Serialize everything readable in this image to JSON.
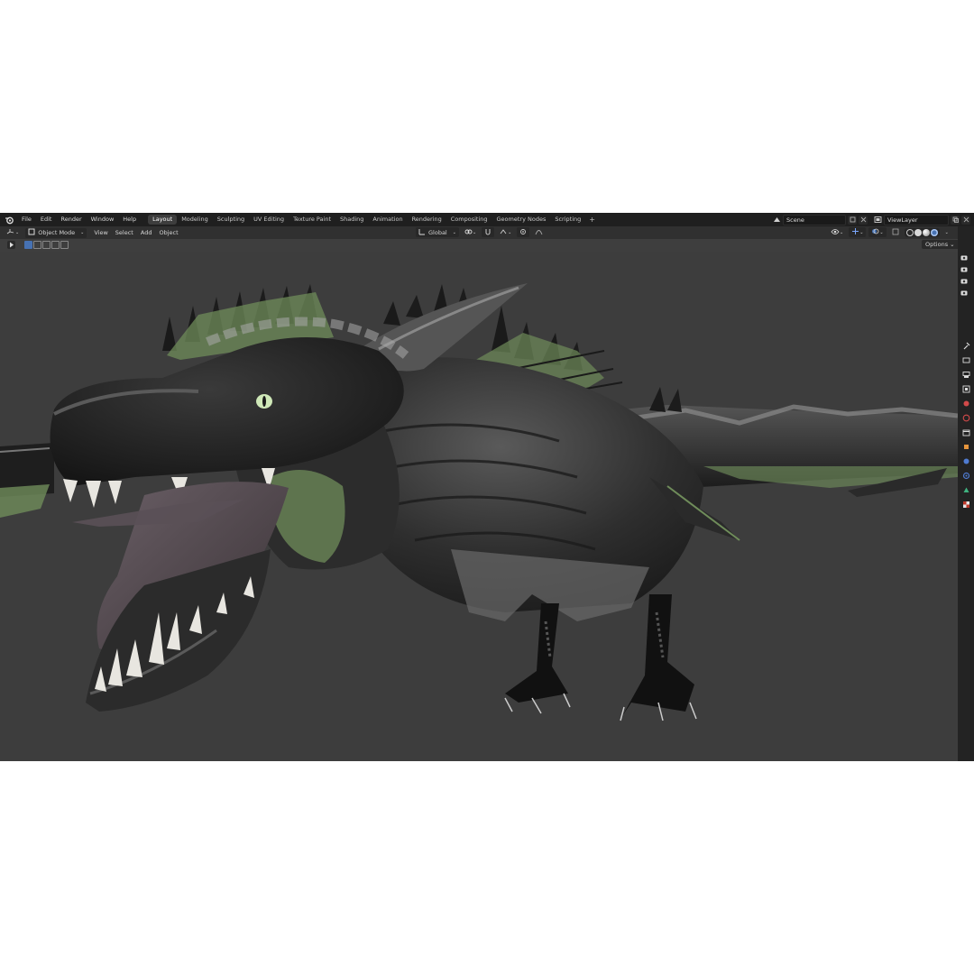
{
  "menu": {
    "items": [
      "File",
      "Edit",
      "Render",
      "Window",
      "Help"
    ]
  },
  "workspaces": {
    "tabs": [
      "Layout",
      "Modeling",
      "Sculpting",
      "UV Editing",
      "Texture Paint",
      "Shading",
      "Animation",
      "Rendering",
      "Compositing",
      "Geometry Nodes",
      "Scripting"
    ],
    "active": "Layout",
    "add_label": "+"
  },
  "scene": {
    "name": "Scene"
  },
  "view_layer": {
    "name": "ViewLayer"
  },
  "header": {
    "mode": "Object Mode",
    "menus": [
      "View",
      "Select",
      "Add",
      "Object"
    ],
    "transform_orientation": "Global",
    "options_label": "Options ⌄"
  },
  "colors": {
    "topbar": "#1f1f1f",
    "header": "#303030",
    "viewport": "#3d3d3d",
    "accent": "#4772b3",
    "dragon_skin": "#2b2b2b",
    "membrane": "#6f8c5a",
    "eye": "#cfe8b8"
  },
  "icons": {
    "app": "blender-logo-icon",
    "editor_type": "3d-viewport-icon",
    "gizmos": [
      "camera-icon",
      "camera-icon",
      "camera-icon",
      "camera-icon"
    ],
    "properties": [
      "tool-icon",
      "render-icon",
      "output-icon",
      "view-layer-icon",
      "scene-icon",
      "world-icon",
      "collection-icon",
      "object-icon",
      "modifier-icon",
      "particles-icon",
      "physics-icon",
      "constraints-icon",
      "data-icon",
      "texture-icon"
    ]
  }
}
